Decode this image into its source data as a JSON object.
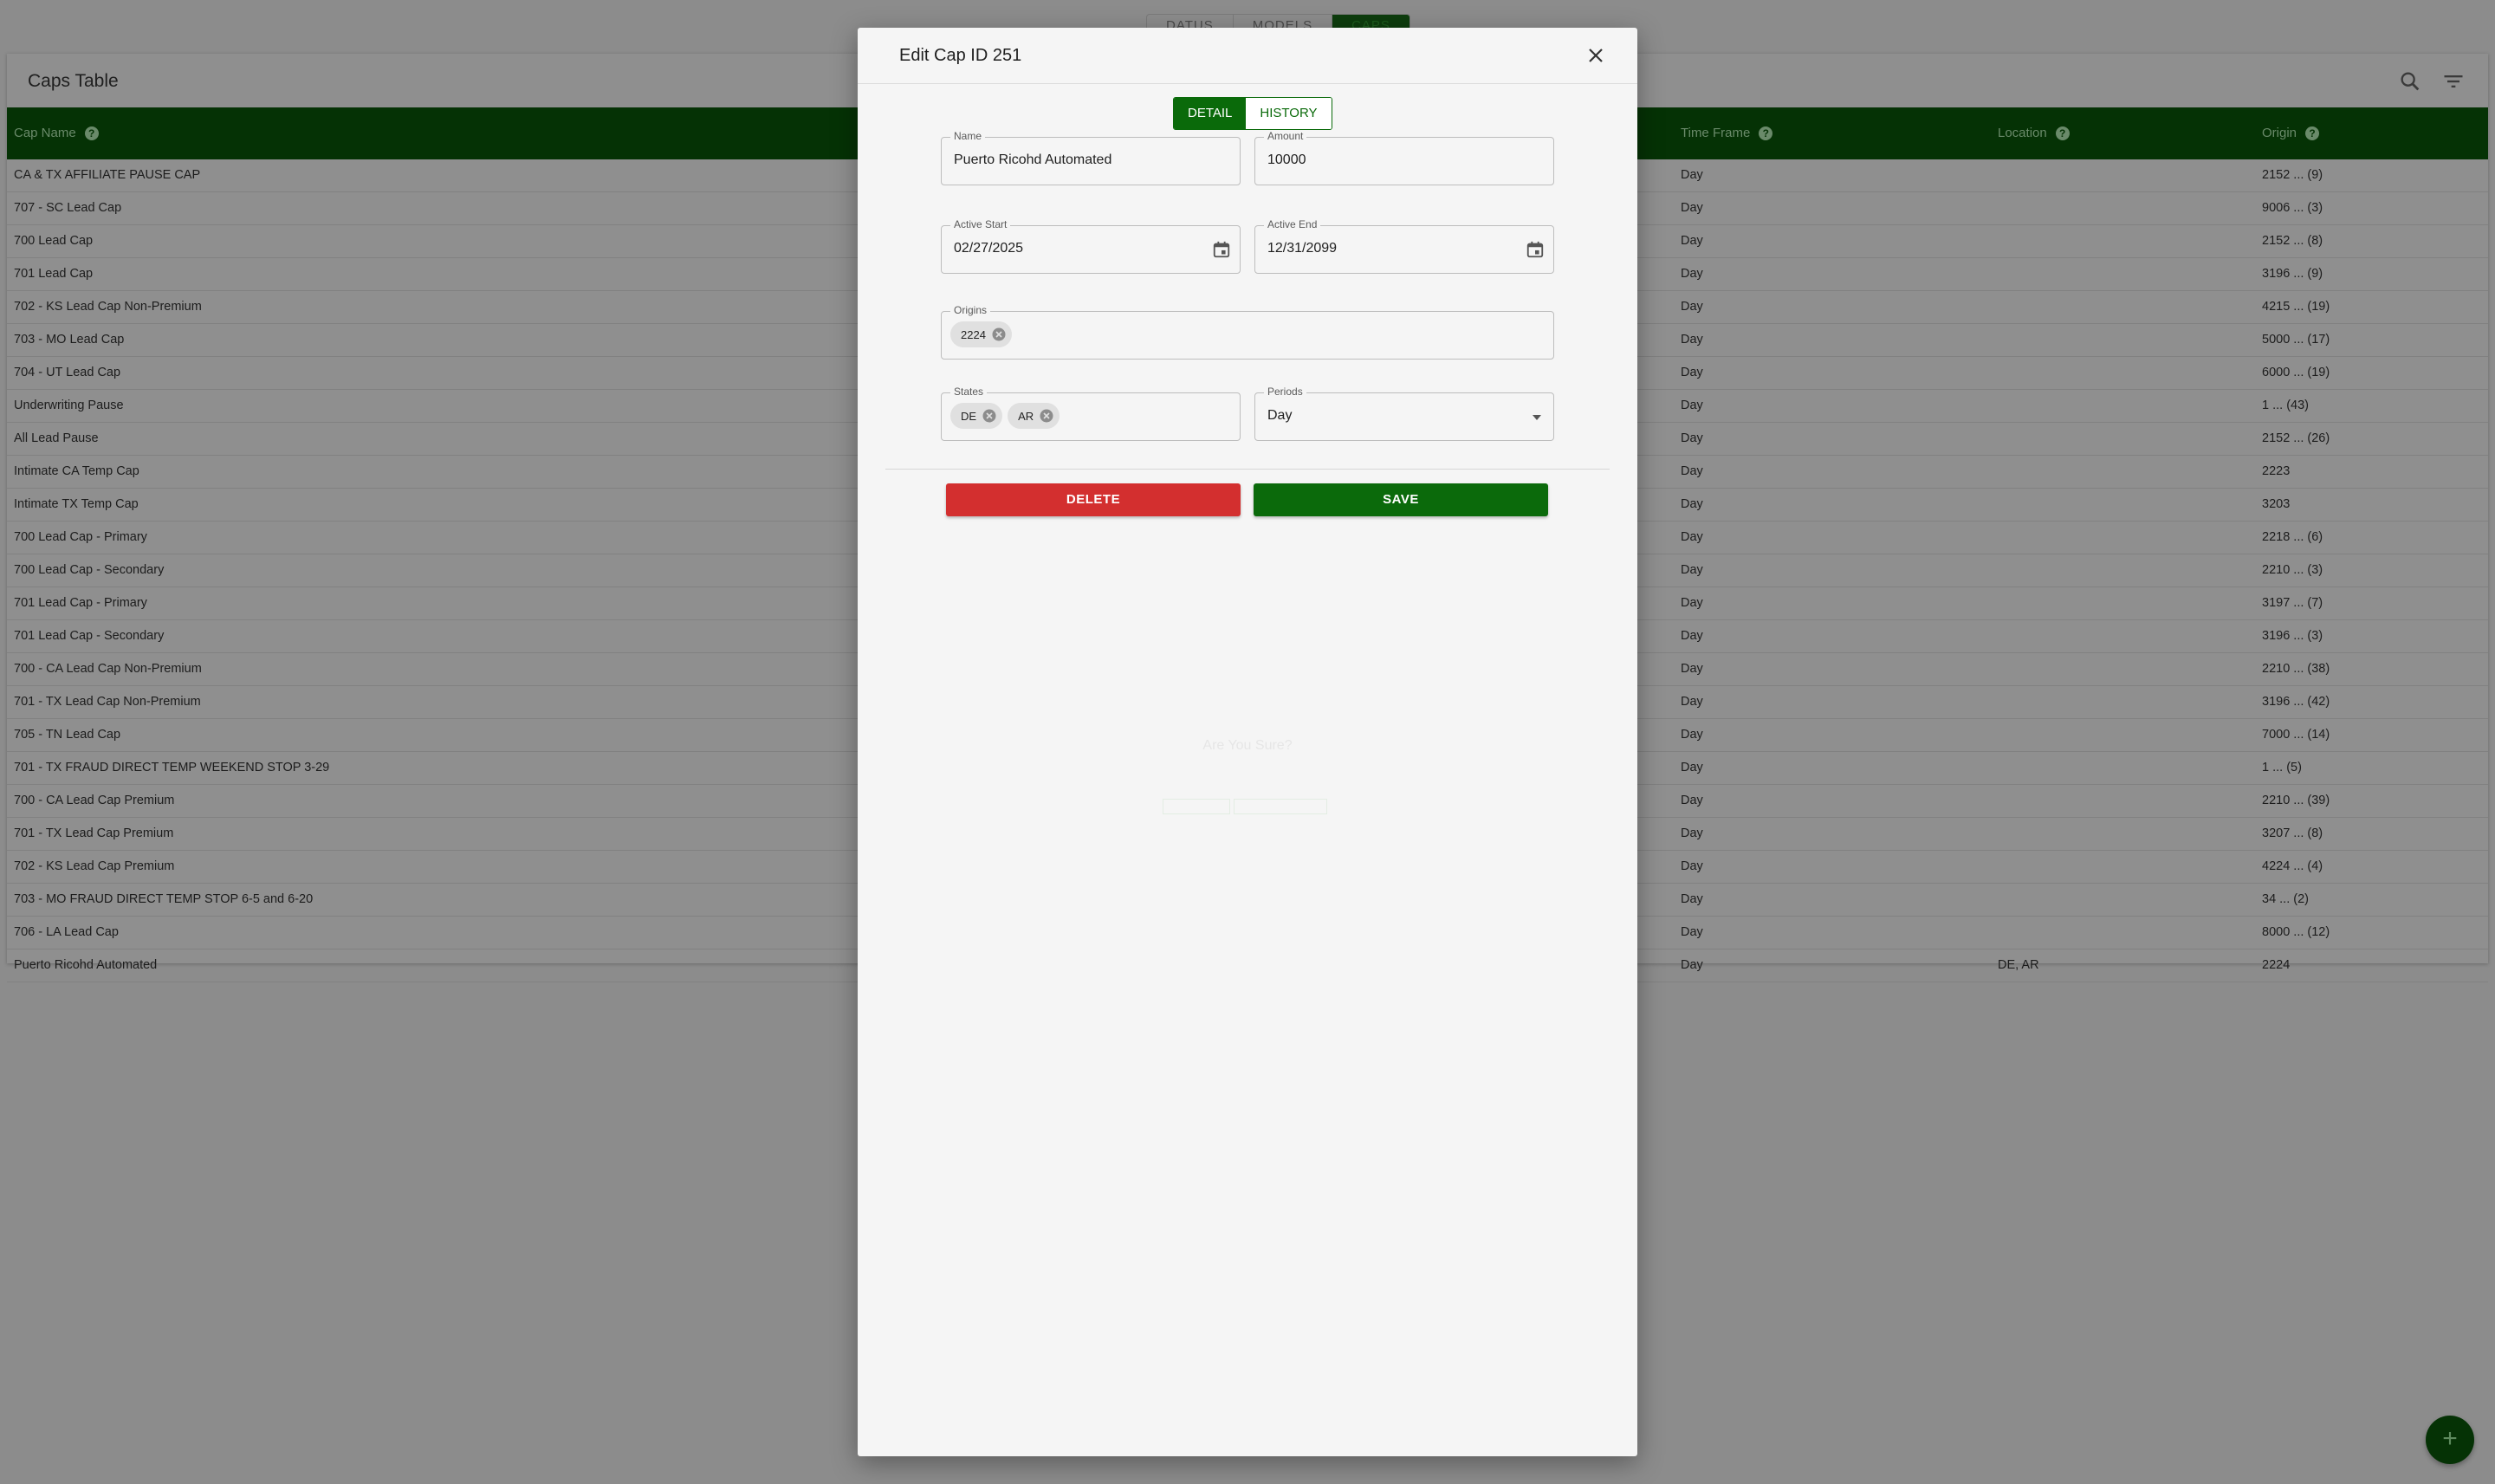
{
  "topnav": {
    "tabs": [
      "DATUS",
      "MODELS",
      "CAPS"
    ],
    "active": "CAPS"
  },
  "table": {
    "title": "Caps Table",
    "columns": {
      "cap_name": "Cap Name",
      "time_frame": "Time Frame",
      "location": "Location",
      "origin": "Origin"
    },
    "rows": [
      {
        "name": "CA & TX AFFILIATE PAUSE CAP",
        "time_frame": "Day",
        "location": "",
        "origin": "2152 ... (9)"
      },
      {
        "name": "707 - SC Lead Cap",
        "time_frame": "Day",
        "location": "",
        "origin": "9006 ... (3)"
      },
      {
        "name": "700 Lead Cap",
        "time_frame": "Day",
        "location": "",
        "origin": "2152 ... (8)"
      },
      {
        "name": "701 Lead Cap",
        "time_frame": "Day",
        "location": "",
        "origin": "3196 ... (9)"
      },
      {
        "name": "702 - KS Lead Cap Non-Premium",
        "time_frame": "Day",
        "location": "",
        "origin": "4215 ... (19)"
      },
      {
        "name": "703 - MO Lead Cap",
        "time_frame": "Day",
        "location": "",
        "origin": "5000 ... (17)"
      },
      {
        "name": "704 - UT Lead Cap",
        "time_frame": "Day",
        "location": "",
        "origin": "6000 ... (19)"
      },
      {
        "name": "Underwriting Pause",
        "time_frame": "Day",
        "location": "",
        "origin": "1 ... (43)"
      },
      {
        "name": "All Lead Pause",
        "time_frame": "Day",
        "location": "",
        "origin": "2152 ... (26)"
      },
      {
        "name": "Intimate CA Temp Cap",
        "time_frame": "Day",
        "location": "",
        "origin": "2223"
      },
      {
        "name": "Intimate TX Temp Cap",
        "time_frame": "Day",
        "location": "",
        "origin": "3203"
      },
      {
        "name": "700 Lead Cap - Primary",
        "time_frame": "Day",
        "location": "",
        "origin": "2218 ... (6)"
      },
      {
        "name": "700 Lead Cap - Secondary",
        "time_frame": "Day",
        "location": "",
        "origin": "2210 ... (3)"
      },
      {
        "name": "701 Lead Cap - Primary",
        "time_frame": "Day",
        "location": "",
        "origin": "3197 ... (7)"
      },
      {
        "name": "701 Lead Cap - Secondary",
        "time_frame": "Day",
        "location": "",
        "origin": "3196 ... (3)"
      },
      {
        "name": "700 - CA Lead Cap Non-Premium",
        "time_frame": "Day",
        "location": "",
        "origin": "2210 ... (38)"
      },
      {
        "name": "701 - TX Lead Cap Non-Premium",
        "time_frame": "Day",
        "location": "",
        "origin": "3196 ... (42)"
      },
      {
        "name": "705 - TN Lead Cap",
        "time_frame": "Day",
        "location": "",
        "origin": "7000 ... (14)"
      },
      {
        "name": "701 - TX FRAUD DIRECT TEMP WEEKEND STOP 3-29",
        "time_frame": "Day",
        "location": "",
        "origin": "1 ... (5)"
      },
      {
        "name": "700 - CA Lead Cap Premium",
        "time_frame": "Day",
        "location": "",
        "origin": "2210 ... (39)"
      },
      {
        "name": "701 - TX Lead Cap Premium",
        "time_frame": "Day",
        "location": "",
        "origin": "3207 ... (8)"
      },
      {
        "name": "702 - KS Lead Cap Premium",
        "time_frame": "Day",
        "location": "",
        "origin": "4224 ... (4)"
      },
      {
        "name": "703 - MO FRAUD DIRECT TEMP STOP 6-5 and 6-20",
        "time_frame": "Day",
        "location": "",
        "origin": "34 ... (2)"
      },
      {
        "name": "706 - LA Lead Cap",
        "time_frame": "Day",
        "location": "",
        "origin": "8000 ... (12)"
      },
      {
        "name": "Puerto Ricohd Automated",
        "time_frame": "Day",
        "location": "DE, AR",
        "origin": "2224"
      }
    ]
  },
  "fab": {
    "icon": "plus-icon",
    "label": "+"
  },
  "modal": {
    "title": "Edit Cap ID 251",
    "tabs": {
      "detail": "DETAIL",
      "history": "HISTORY",
      "active": "DETAIL"
    },
    "fields": {
      "name": {
        "label": "Name",
        "value": "Puerto Ricohd Automated"
      },
      "amount": {
        "label": "Amount",
        "value": "10000"
      },
      "active_start": {
        "label": "Active Start",
        "value": "02/27/2025"
      },
      "active_end": {
        "label": "Active End",
        "value": "12/31/2099"
      },
      "origins": {
        "label": "Origins",
        "chips": [
          "2224"
        ]
      },
      "states": {
        "label": "States",
        "chips": [
          "DE",
          "AR"
        ]
      },
      "periods": {
        "label": "Periods",
        "value": "Day"
      }
    },
    "buttons": {
      "delete": "DELETE",
      "save": "SAVE"
    },
    "ghost_dialog": {
      "title": "Are You Sure?"
    }
  },
  "colors": {
    "brand_green": "#0b6a0b",
    "danger_red": "#d32f2f"
  }
}
